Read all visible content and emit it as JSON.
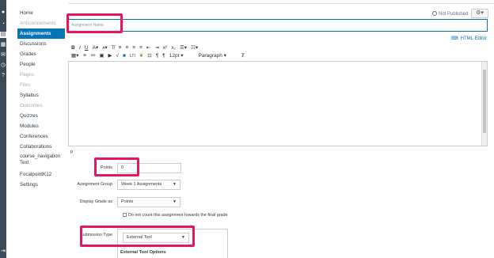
{
  "course_nav": {
    "items": [
      {
        "label": "Home",
        "state": "normal"
      },
      {
        "label": "Announcements",
        "state": "disabled"
      },
      {
        "label": "Assignments",
        "state": "active"
      },
      {
        "label": "Discussions",
        "state": "normal"
      },
      {
        "label": "Grades",
        "state": "normal"
      },
      {
        "label": "People",
        "state": "normal"
      },
      {
        "label": "Pages",
        "state": "disabled"
      },
      {
        "label": "Files",
        "state": "disabled"
      },
      {
        "label": "Syllabus",
        "state": "normal"
      },
      {
        "label": "Outcomes",
        "state": "disabled"
      },
      {
        "label": "Quizzes",
        "state": "normal"
      },
      {
        "label": "Modules",
        "state": "normal"
      },
      {
        "label": "Conferences",
        "state": "normal"
      },
      {
        "label": "Collaborations",
        "state": "normal"
      },
      {
        "label": "course_navigation Text",
        "state": "normal"
      },
      {
        "label": "FocalpointK12",
        "state": "normal"
      },
      {
        "label": "Settings",
        "state": "normal"
      }
    ]
  },
  "header": {
    "status": "Not Published",
    "gear": "⚙▾"
  },
  "assignment_name": {
    "placeholder": "Assignment Name"
  },
  "editor": {
    "html_editor_link": "HTML Editor",
    "font_size": "12pt",
    "block_format": "Paragraph",
    "path": "p"
  },
  "form": {
    "points_label": "Points",
    "points_value": "0",
    "group_label": "Assignment Group",
    "group_value": "Week 1 Assignments",
    "display_label": "Display Grade as",
    "display_value": "Points",
    "no_count_label": "Do not count this assignment towards the final grade",
    "submission_label": "Submission Type",
    "submission_value": "External Tool",
    "external_tool_title": "External Tool Options"
  },
  "colors": {
    "accent": "#0374b5",
    "highlight": "#e8175d",
    "global_nav": "#394b58"
  },
  "icons": {
    "caret": "▼"
  }
}
